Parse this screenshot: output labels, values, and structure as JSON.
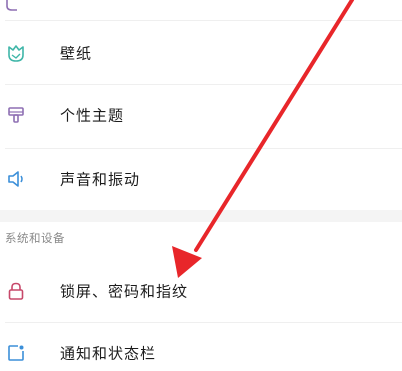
{
  "settings": {
    "items_top": [
      {
        "label": "壁纸",
        "icon": "wallpaper-icon"
      },
      {
        "label": "个性主题",
        "icon": "theme-brush-icon"
      },
      {
        "label": "声音和振动",
        "icon": "speaker-icon"
      }
    ],
    "section_header": "系统和设备",
    "items_system": [
      {
        "label": "锁屏、密码和指纹",
        "icon": "lock-icon"
      },
      {
        "label": "通知和状态栏",
        "icon": "notification-icon"
      }
    ]
  },
  "colors": {
    "icon_teal": "#3fb6a8",
    "icon_purple": "#8e6fb3",
    "icon_blue": "#3b8fd9",
    "icon_lock": "#c7486a",
    "arrow_red": "#e8262a",
    "section_bg": "#f4f4f4"
  }
}
